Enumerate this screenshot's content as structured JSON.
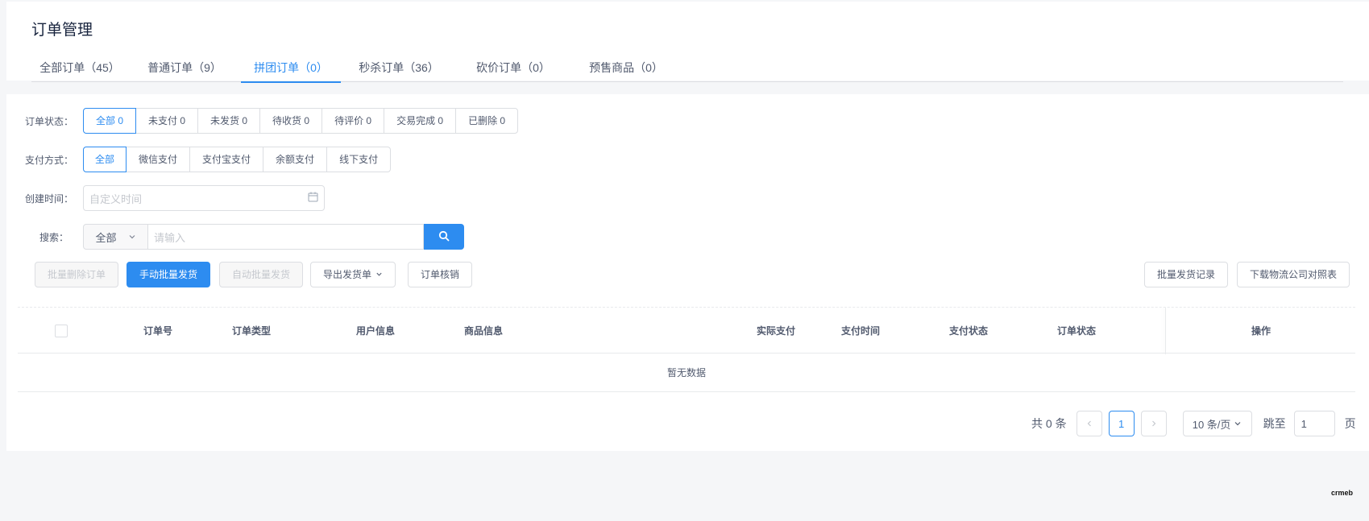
{
  "page": {
    "title": "订单管理"
  },
  "tabs": [
    {
      "label": "全部订单（45）",
      "active": false
    },
    {
      "label": "普通订单（9）",
      "active": false
    },
    {
      "label": "拼团订单（0）",
      "active": true
    },
    {
      "label": "秒杀订单（36）",
      "active": false
    },
    {
      "label": "砍价订单（0）",
      "active": false
    },
    {
      "label": "预售商品（0）",
      "active": false
    }
  ],
  "filters": {
    "order_status": {
      "label": "订单状态：",
      "options": [
        "全部 0",
        "未支付 0",
        "未发货 0",
        "待收货 0",
        "待评价 0",
        "交易完成 0",
        "已删除 0"
      ],
      "selected": "全部 0"
    },
    "payment_method": {
      "label": "支付方式：",
      "options": [
        "全部",
        "微信支付",
        "支付宝支付",
        "余额支付",
        "线下支付"
      ],
      "selected": "全部"
    },
    "created_time": {
      "label": "创建时间：",
      "placeholder": "自定义时间",
      "icon": "calendar-icon"
    },
    "search": {
      "label": "搜索：",
      "scope_value": "全部",
      "placeholder": "请输入",
      "icon": "search-icon"
    }
  },
  "actions": {
    "batch_delete": "批量删除订单",
    "manual_batch_ship": "手动批量发货",
    "auto_batch_ship": "自动批量发货",
    "export_shipping": "导出发货单",
    "order_verify": "订单核销",
    "batch_ship_records": "批量发货记录",
    "download_logistics": "下载物流公司对照表"
  },
  "table": {
    "columns": [
      "订单号",
      "订单类型",
      "用户信息",
      "商品信息",
      "实际支付",
      "支付时间",
      "支付状态",
      "订单状态",
      "操作"
    ],
    "empty_text": "暂无数据"
  },
  "pagination": {
    "total_text": "共 0 条",
    "current_page": "1",
    "page_size": "10 条/页",
    "jump_label": "跳至",
    "jump_value": "1",
    "page_suffix": "页"
  },
  "branding": {
    "logo_text": "crmeb"
  },
  "colors": {
    "accent": "#2d8cf0",
    "border": "#dcdee2",
    "background": "#f5f6f8"
  }
}
